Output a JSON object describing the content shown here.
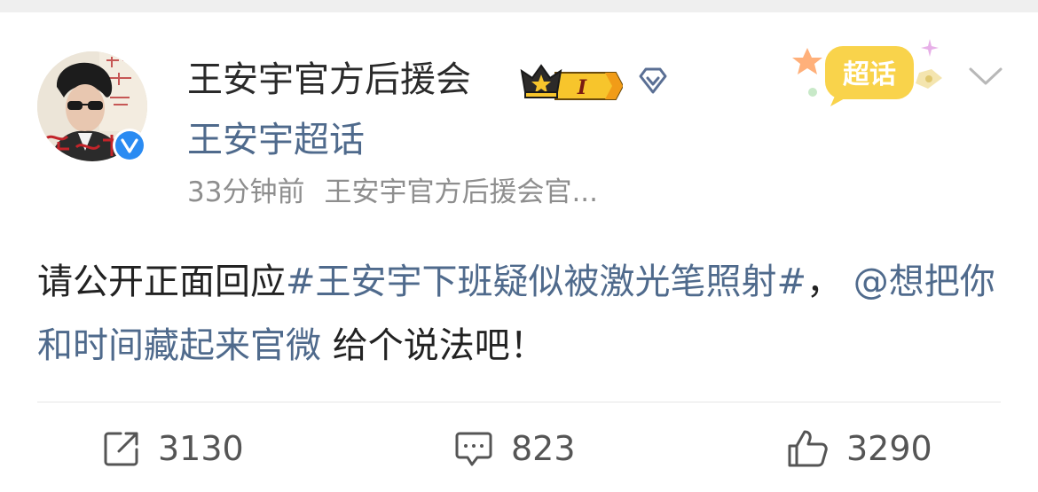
{
  "post": {
    "username": "王安宇官方后援会",
    "super_topic_link": "王安宇超话",
    "timestamp": "33分钟前",
    "source": "王安宇官方后援会官...",
    "content": {
      "prefix": "请公开正面回应",
      "hashtag": "#王安宇下班疑似被激光笔照射#",
      "separator": "，",
      "mention": "@想把你和时间藏起来官微",
      "suffix": " 给个说法吧！"
    },
    "level_badge": "I",
    "sticker_label": "超话"
  },
  "actions": {
    "repost_count": "3130",
    "comment_count": "823",
    "like_count": "3290"
  },
  "icons": [
    "verified-icon",
    "crown-icon",
    "diamond-icon",
    "super-topic-sticker",
    "chevron-down-icon",
    "repost-icon",
    "comment-icon",
    "like-icon"
  ],
  "colors": {
    "link": "#4f6a8c",
    "meta": "#8e8e8e",
    "verified": "#2a8bf2",
    "badge_gold": "#f2b21e"
  }
}
